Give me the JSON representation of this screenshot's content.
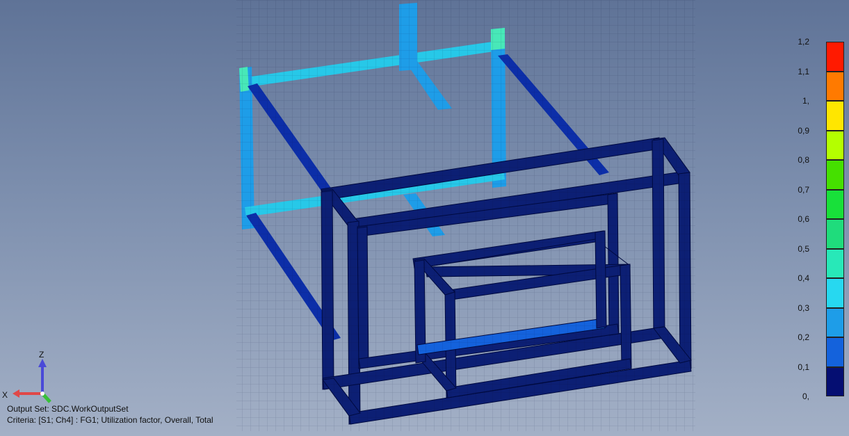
{
  "info": {
    "output_set": "Output Set: SDC.WorkOutputSet",
    "criteria": "Criteria: [S1; Ch4] : FG1; Utilization factor, Overall, Total"
  },
  "legend": {
    "labels": [
      "1,2",
      "1,1",
      "1,",
      "0,9",
      "0,8",
      "0,7",
      "0,6",
      "0,5",
      "0,4",
      "0,3",
      "0,2",
      "0,1",
      "0,"
    ],
    "colors": [
      "#ff1a00",
      "#ff7a00",
      "#ffe600",
      "#b4ff00",
      "#45e000",
      "#18e03a",
      "#1fdc7c",
      "#28e8b8",
      "#27d8f0",
      "#1e9de8",
      "#1462dc",
      "#0c2ea8",
      "#050e72"
    ]
  },
  "axes": {
    "z": "Z",
    "x": "X",
    "z_color": "#4a4ad8",
    "x_color": "#e04848",
    "y_color": "#38c038"
  },
  "model": {
    "beam_color": "#0c1f74",
    "edge_color": "#000a40",
    "stressed_color": "#27a6ee",
    "peak_color": "#48e8b8"
  }
}
